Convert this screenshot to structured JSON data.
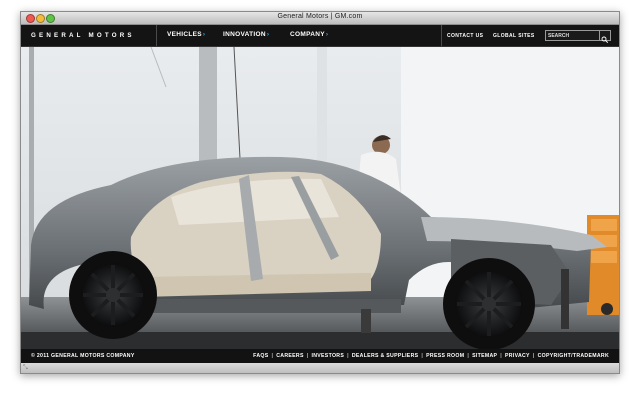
{
  "window": {
    "title": "General Motors | GM.com"
  },
  "header": {
    "logo": "GENERAL MOTORS",
    "nav": [
      {
        "label": "VEHICLES",
        "name": "nav-vehicles"
      },
      {
        "label": "INNOVATION",
        "name": "nav-innovation"
      },
      {
        "label": "COMPANY",
        "name": "nav-company"
      }
    ],
    "nav_chevron": "›",
    "utility": {
      "contact": "CONTACT US",
      "global": "GLOBAL SITES"
    },
    "search": {
      "placeholder": "SEARCH",
      "icon": "search-icon"
    }
  },
  "footer": {
    "copyright": "© 2011 GENERAL MOTORS COMPANY",
    "links": [
      "FAQS",
      "CAREERS",
      "INVESTORS",
      "DEALERS & SUPPLIERS",
      "PRESS ROOM",
      "SITEMAP",
      "PRIVACY",
      "COPYRIGHT/TRADEMARK"
    ],
    "separator": "|"
  },
  "colors": {
    "accent": "#3fa7e6",
    "bar": "#141414"
  }
}
